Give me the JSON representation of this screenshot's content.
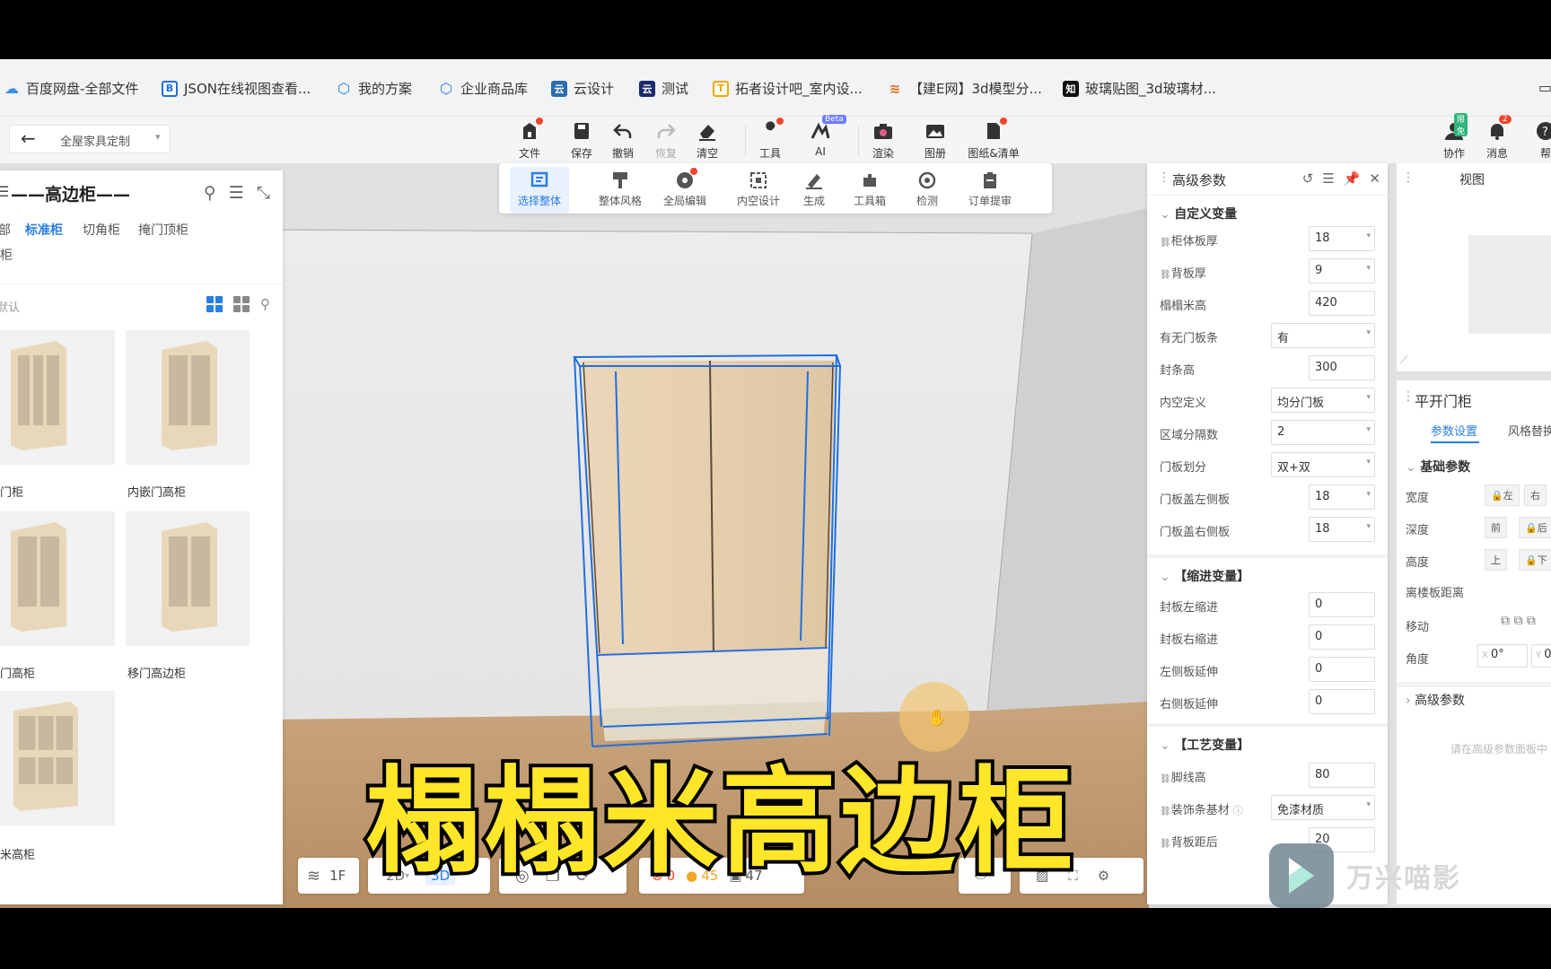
{
  "bookmarks": [
    {
      "label": "百度网盘-全部文件",
      "icon": "cloud-icon",
      "color": "#3a8ee6"
    },
    {
      "label": "JSON在线视图查看...",
      "icon": "b-letter-icon",
      "color": "#1e6fd9"
    },
    {
      "label": "我的方案",
      "icon": "shield-icon",
      "color": "#2a7de1"
    },
    {
      "label": "企业商品库",
      "icon": "shield-icon",
      "color": "#2a7de1"
    },
    {
      "label": "云设计",
      "icon": "cloud-design-icon",
      "color": "#2b6cb0"
    },
    {
      "label": "测试",
      "icon": "cloud-design-icon",
      "color": "#1b2a6b"
    },
    {
      "label": "拓者设计吧_室内设...",
      "icon": "tuozhe-icon",
      "color": "#f0a800"
    },
    {
      "label": "【建E网】3d模型分...",
      "icon": "jiane-icon",
      "color": "#e36b1f"
    },
    {
      "label": "玻璃贴图_3d玻璃材...",
      "icon": "zhi-icon",
      "color": "#111111"
    }
  ],
  "appbar": {
    "dropdown_value": "全屋家具定制",
    "tools": [
      {
        "label": "文件",
        "icon": "file-icon",
        "dot": true
      },
      {
        "label": "保存",
        "icon": "save-icon"
      },
      {
        "label": "撤销",
        "icon": "undo-icon"
      },
      {
        "label": "恢复",
        "icon": "redo-icon",
        "disabled": true
      },
      {
        "label": "清空",
        "icon": "eraser-icon"
      },
      {
        "label": "工具",
        "icon": "wrench-icon",
        "dot": true
      },
      {
        "label": "AI",
        "icon": "ai-icon",
        "badge": "Beta"
      },
      {
        "label": "渲染",
        "icon": "camera-icon"
      },
      {
        "label": "图册",
        "icon": "album-icon"
      },
      {
        "label": "图纸&清单",
        "icon": "drawing-list-icon",
        "dot": true
      }
    ],
    "right_tools": [
      {
        "label": "协作",
        "icon": "collab-icon",
        "badge": "限免"
      },
      {
        "label": "消息",
        "icon": "bell-icon",
        "badge": "2"
      },
      {
        "label": "帮",
        "icon": "help-icon"
      }
    ]
  },
  "left_panel": {
    "title": "——高边柜——",
    "tabs": [
      "部",
      "标准柜",
      "切角柜",
      "掩门顶柜",
      "酒柜"
    ],
    "active_tab": "标准柜",
    "sort_label": "默认",
    "items": [
      {
        "label": "门柜"
      },
      {
        "label": "内嵌门高柜"
      },
      {
        "label": "门高柜"
      },
      {
        "label": "移门高边柜"
      },
      {
        "label": "米高柜"
      }
    ]
  },
  "float_toolbar": [
    {
      "label": "选择整体",
      "icon": "select-all-icon",
      "active": true
    },
    {
      "label": "整体风格",
      "icon": "style-icon"
    },
    {
      "label": "全局编辑",
      "icon": "global-edit-icon",
      "dot": true
    },
    {
      "label": "内空设计",
      "icon": "interior-icon"
    },
    {
      "label": "生成",
      "icon": "generate-icon"
    },
    {
      "label": "工具箱",
      "icon": "toolbox-icon"
    },
    {
      "label": "检测",
      "icon": "check-icon"
    },
    {
      "label": "订单提审",
      "icon": "order-icon"
    }
  ],
  "adv_panel": {
    "title": "高级参数",
    "sections": {
      "custom": "自定义变量",
      "indent": "【缩进变量】",
      "craft": "【工艺变量】"
    },
    "custom_rows": [
      {
        "label": "柜体板厚",
        "value": "18",
        "select": true,
        "link": true
      },
      {
        "label": "背板厚",
        "value": "9",
        "select": true,
        "link": true
      },
      {
        "label": "榻榻米高",
        "value": "420"
      },
      {
        "label": "有无门板条",
        "value": "有",
        "select": true,
        "wide": true
      },
      {
        "label": "封条高",
        "value": "300"
      },
      {
        "label": "内空定义",
        "value": "均分门板",
        "select": true,
        "wide": true
      },
      {
        "label": "区域分隔数",
        "value": "2",
        "select": true,
        "wide": true
      },
      {
        "label": "门板划分",
        "value": "双+双",
        "select": true,
        "wide": true
      },
      {
        "label": "门板盖左侧板",
        "value": "18",
        "select": true
      },
      {
        "label": "门板盖右侧板",
        "value": "18",
        "select": true
      }
    ],
    "indent_rows": [
      {
        "label": "封板左缩进",
        "value": "0"
      },
      {
        "label": "封板右缩进",
        "value": "0"
      },
      {
        "label": "左侧板延伸",
        "value": "0"
      },
      {
        "label": "右侧板延伸",
        "value": "0"
      }
    ],
    "craft_rows": [
      {
        "label": "脚线高",
        "value": "80",
        "link": true
      },
      {
        "label": "装饰条基材",
        "value": "免漆材质",
        "select": true,
        "wide": true,
        "link": true,
        "help": true
      },
      {
        "label": "背板距后",
        "value": "20",
        "link": true
      }
    ]
  },
  "view_panel": {
    "title": "视图"
  },
  "props_panel": {
    "title": "平开门柜",
    "tabs": [
      "参数设置",
      "风格替换"
    ],
    "section": "基础参数",
    "rows": [
      {
        "label": "宽度",
        "a": "左",
        "b": "右"
      },
      {
        "label": "深度",
        "a": "前",
        "b": "后"
      },
      {
        "label": "高度",
        "a": "上",
        "b": "下"
      },
      {
        "label": "离楼板距离"
      },
      {
        "label": "移动"
      },
      {
        "label": "角度",
        "x": "0°",
        "y": "0"
      }
    ],
    "adv_label": "高级参数",
    "hint": "请在高级参数面板中"
  },
  "bottom_bar": {
    "floor": "1F",
    "mode_2d": "2D",
    "mode_3d": "3D",
    "errors": "0",
    "warnings": "45",
    "items": "47"
  },
  "overlay_title": "榻榻米高边柜",
  "watermark": "万兴喵影",
  "colors": {
    "accent": "#2a7de1",
    "selection": "#1f6fe0",
    "overlay_text": "#ffe629",
    "wood": "#e8d3b5"
  }
}
